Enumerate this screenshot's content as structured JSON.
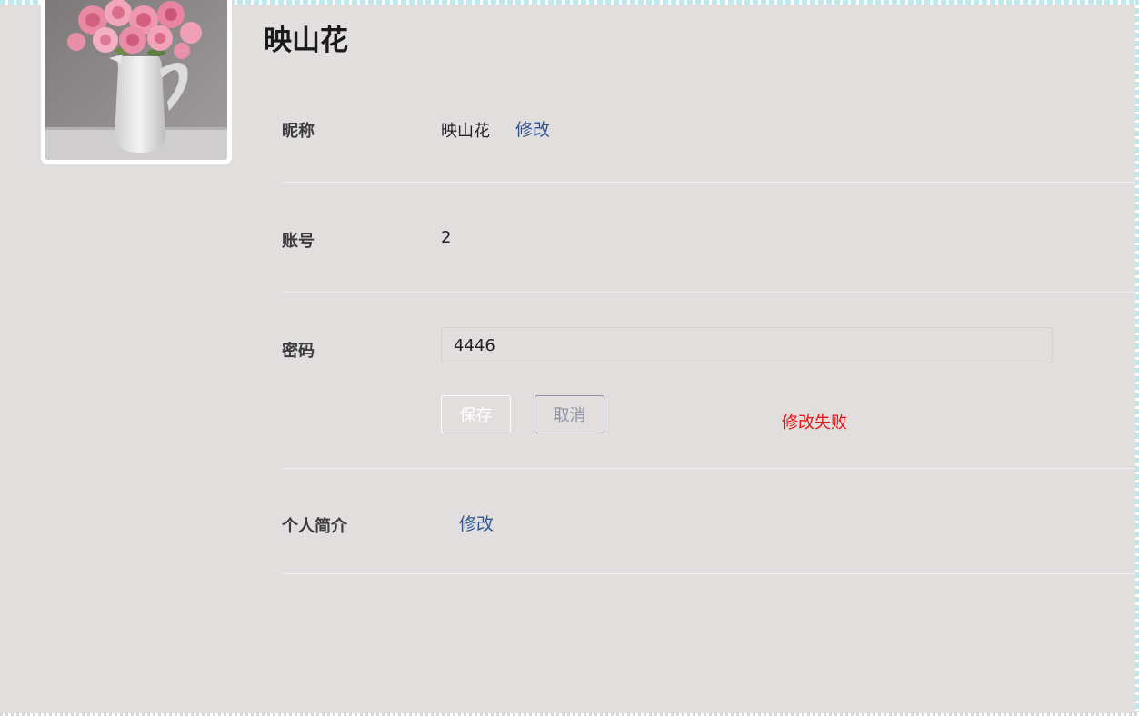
{
  "profile": {
    "name": "映山花",
    "avatar_icon": "flower-vase-photo"
  },
  "fields": {
    "nickname": {
      "label": "昵称",
      "value": "映山花",
      "edit_link": "修改"
    },
    "account": {
      "label": "账号",
      "value": "2"
    },
    "password": {
      "label": "密码",
      "value": "4446",
      "save_label": "保存",
      "cancel_label": "取消",
      "error_text": "修改失败"
    },
    "bio": {
      "label": "个人简介",
      "value": "",
      "edit_link": "修改"
    }
  },
  "colors": {
    "panel_bg": "#e1dedd",
    "link": "#2d5595",
    "error": "#ef1414",
    "cancel_border": "#8c94a6"
  }
}
